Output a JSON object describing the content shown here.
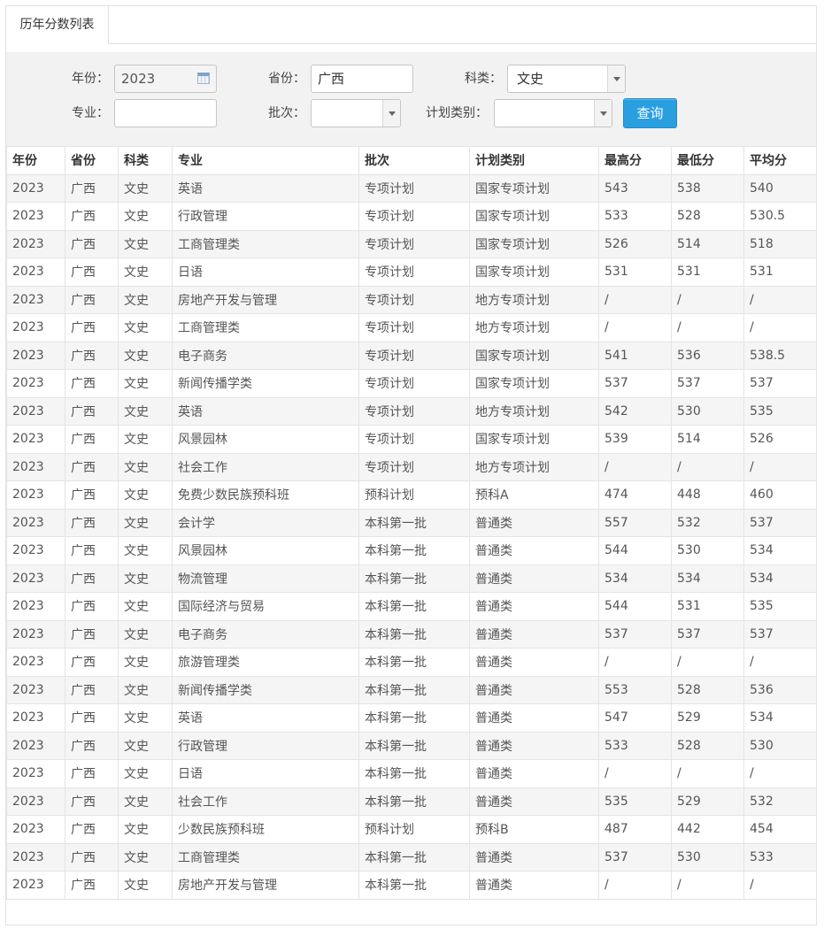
{
  "tab": {
    "label": "历年分数列表"
  },
  "filters": {
    "year_label": "年份：",
    "year_value": "2023",
    "province_label": "省份：",
    "province_value": "广西",
    "category_label": "科类：",
    "category_value": "文史",
    "major_label": "专业：",
    "major_value": "",
    "batch_label": "批次：",
    "batch_value": "",
    "plan_type_label": "计划类别：",
    "plan_type_value": "",
    "query_button": "查询"
  },
  "icons": {
    "calendar": "calendar-icon",
    "dropdown": "chevron-down-icon"
  },
  "colors": {
    "button": "#2a9fe0",
    "filter_bg": "#f2f2f2"
  },
  "table": {
    "headers": [
      "年份",
      "省份",
      "科类",
      "专业",
      "批次",
      "计划类别",
      "最高分",
      "最低分",
      "平均分"
    ],
    "rows": [
      [
        "2023",
        "广西",
        "文史",
        "英语",
        "专项计划",
        "国家专项计划",
        "543",
        "538",
        "540"
      ],
      [
        "2023",
        "广西",
        "文史",
        "行政管理",
        "专项计划",
        "国家专项计划",
        "533",
        "528",
        "530.5"
      ],
      [
        "2023",
        "广西",
        "文史",
        "工商管理类",
        "专项计划",
        "国家专项计划",
        "526",
        "514",
        "518"
      ],
      [
        "2023",
        "广西",
        "文史",
        "日语",
        "专项计划",
        "国家专项计划",
        "531",
        "531",
        "531"
      ],
      [
        "2023",
        "广西",
        "文史",
        "房地产开发与管理",
        "专项计划",
        "地方专项计划",
        "/",
        "/",
        "/"
      ],
      [
        "2023",
        "广西",
        "文史",
        "工商管理类",
        "专项计划",
        "地方专项计划",
        "/",
        "/",
        "/"
      ],
      [
        "2023",
        "广西",
        "文史",
        "电子商务",
        "专项计划",
        "国家专项计划",
        "541",
        "536",
        "538.5"
      ],
      [
        "2023",
        "广西",
        "文史",
        "新闻传播学类",
        "专项计划",
        "国家专项计划",
        "537",
        "537",
        "537"
      ],
      [
        "2023",
        "广西",
        "文史",
        "英语",
        "专项计划",
        "地方专项计划",
        "542",
        "530",
        "535"
      ],
      [
        "2023",
        "广西",
        "文史",
        "风景园林",
        "专项计划",
        "国家专项计划",
        "539",
        "514",
        "526"
      ],
      [
        "2023",
        "广西",
        "文史",
        "社会工作",
        "专项计划",
        "地方专项计划",
        "/",
        "/",
        "/"
      ],
      [
        "2023",
        "广西",
        "文史",
        "免费少数民族预科班",
        "预科计划",
        "预科A",
        "474",
        "448",
        "460"
      ],
      [
        "2023",
        "广西",
        "文史",
        "会计学",
        "本科第一批",
        "普通类",
        "557",
        "532",
        "537"
      ],
      [
        "2023",
        "广西",
        "文史",
        "风景园林",
        "本科第一批",
        "普通类",
        "544",
        "530",
        "534"
      ],
      [
        "2023",
        "广西",
        "文史",
        "物流管理",
        "本科第一批",
        "普通类",
        "534",
        "534",
        "534"
      ],
      [
        "2023",
        "广西",
        "文史",
        "国际经济与贸易",
        "本科第一批",
        "普通类",
        "544",
        "531",
        "535"
      ],
      [
        "2023",
        "广西",
        "文史",
        "电子商务",
        "本科第一批",
        "普通类",
        "537",
        "537",
        "537"
      ],
      [
        "2023",
        "广西",
        "文史",
        "旅游管理类",
        "本科第一批",
        "普通类",
        "/",
        "/",
        "/"
      ],
      [
        "2023",
        "广西",
        "文史",
        "新闻传播学类",
        "本科第一批",
        "普通类",
        "553",
        "528",
        "536"
      ],
      [
        "2023",
        "广西",
        "文史",
        "英语",
        "本科第一批",
        "普通类",
        "547",
        "529",
        "534"
      ],
      [
        "2023",
        "广西",
        "文史",
        "行政管理",
        "本科第一批",
        "普通类",
        "533",
        "528",
        "530"
      ],
      [
        "2023",
        "广西",
        "文史",
        "日语",
        "本科第一批",
        "普通类",
        "/",
        "/",
        "/"
      ],
      [
        "2023",
        "广西",
        "文史",
        "社会工作",
        "本科第一批",
        "普通类",
        "535",
        "529",
        "532"
      ],
      [
        "2023",
        "广西",
        "文史",
        "少数民族预科班",
        "预科计划",
        "预科B",
        "487",
        "442",
        "454"
      ],
      [
        "2023",
        "广西",
        "文史",
        "工商管理类",
        "本科第一批",
        "普通类",
        "537",
        "530",
        "533"
      ],
      [
        "2023",
        "广西",
        "文史",
        "房地产开发与管理",
        "本科第一批",
        "普通类",
        "/",
        "/",
        "/"
      ]
    ]
  }
}
